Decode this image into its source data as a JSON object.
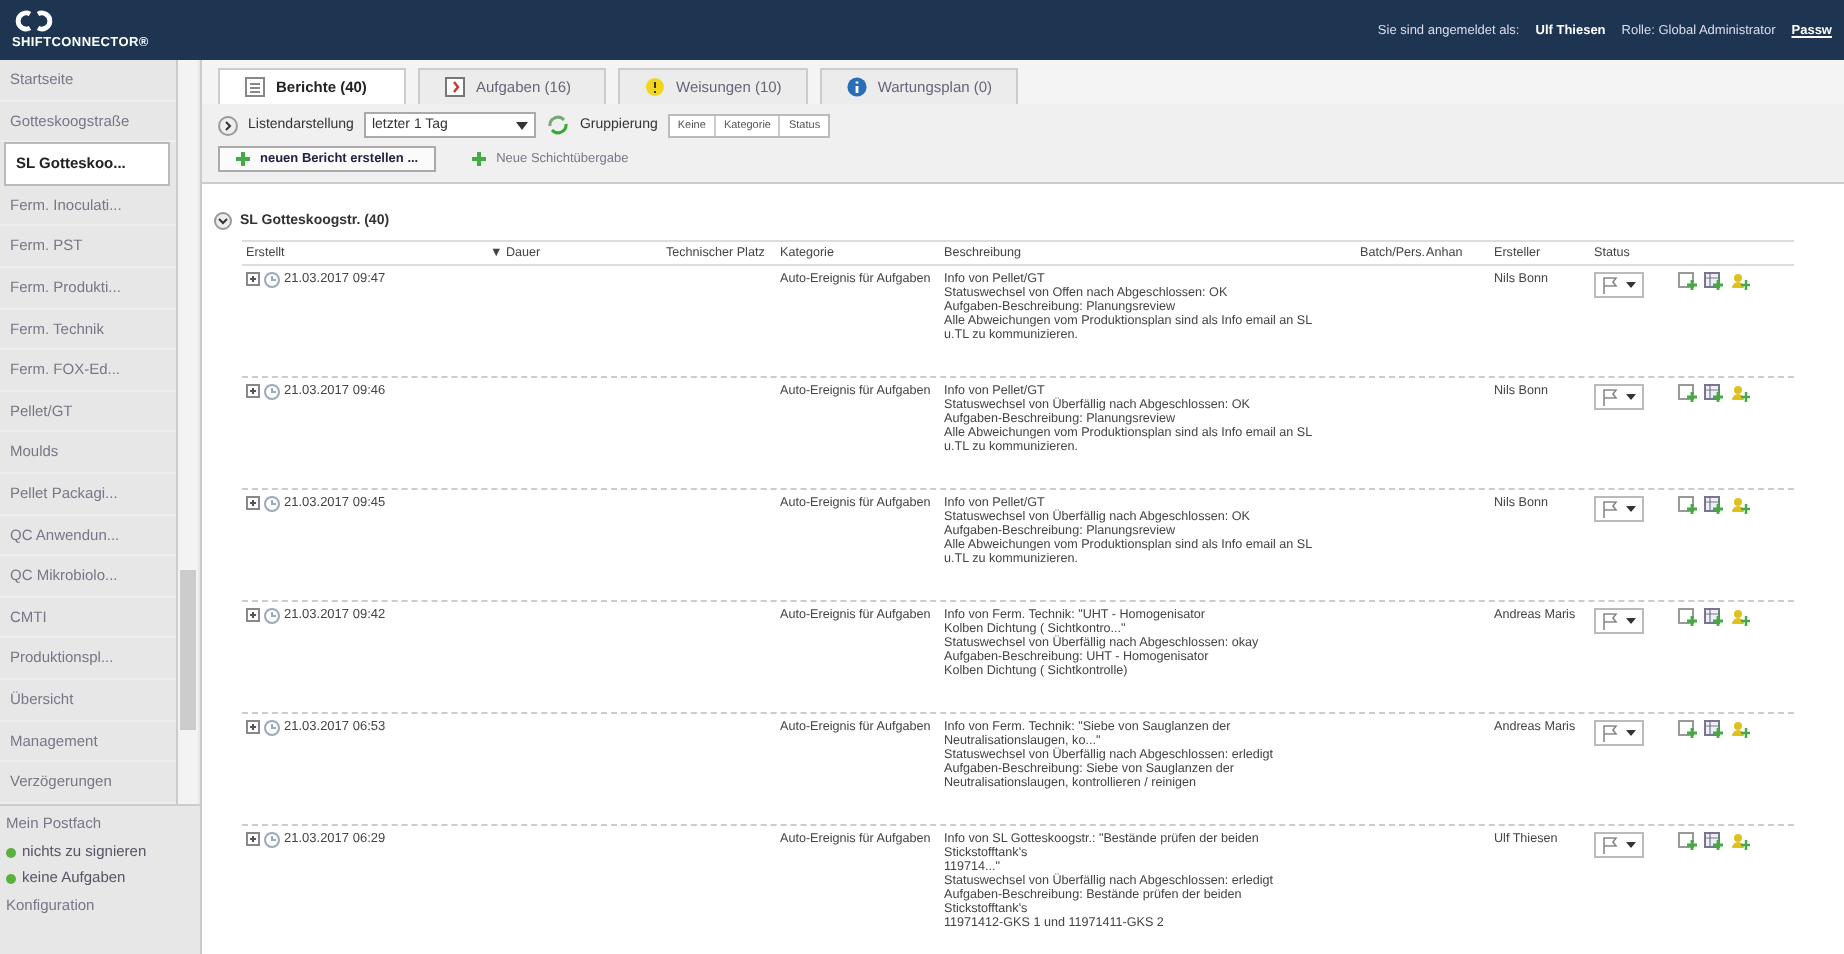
{
  "header": {
    "brand": "SHIFTCONNECTOR®",
    "login_label": "Sie sind angemeldet als:",
    "user": "Ulf Thiesen",
    "role": "Rolle: Global Administrator",
    "link": "Passw"
  },
  "sidebar": {
    "items": [
      {
        "label": "Startseite",
        "selected": false
      },
      {
        "label": "Gotteskoogstraße",
        "selected": false
      },
      {
        "label": "SL Gotteskoo...",
        "selected": true
      },
      {
        "label": "Ferm. Inoculati...",
        "selected": false
      },
      {
        "label": "Ferm. PST",
        "selected": false
      },
      {
        "label": "Ferm. Produkti...",
        "selected": false
      },
      {
        "label": "Ferm. Technik",
        "selected": false
      },
      {
        "label": "Ferm. FOX-Ed...",
        "selected": false
      },
      {
        "label": "Pellet/GT",
        "selected": false
      },
      {
        "label": "Moulds",
        "selected": false
      },
      {
        "label": "Pellet Packagi...",
        "selected": false
      },
      {
        "label": "QC Anwendun...",
        "selected": false
      },
      {
        "label": "QC Mikrobiolo...",
        "selected": false
      },
      {
        "label": "CMTI",
        "selected": false
      },
      {
        "label": "Produktionspl...",
        "selected": false
      },
      {
        "label": "Übersicht",
        "selected": false
      },
      {
        "label": "Management",
        "selected": false
      },
      {
        "label": "Verzögerungen",
        "selected": false
      }
    ],
    "mailbox": {
      "title": "Mein Postfach",
      "items": [
        {
          "label": "nichts zu signieren",
          "color": "#5cb040"
        },
        {
          "label": "keine Aufgaben",
          "color": "#5cb040"
        }
      ]
    },
    "config": "Konfiguration"
  },
  "tabs": [
    {
      "label": "Berichte (40)",
      "selected": true
    },
    {
      "label": "Aufgaben (16)",
      "selected": false
    },
    {
      "label": "Weisungen (10)",
      "selected": false
    },
    {
      "label": "Wartungsplan (0)",
      "selected": false
    }
  ],
  "toolbar": {
    "view_label": "Listendarstellung",
    "range": "letzter 1 Tag",
    "group_label": "Gruppierung",
    "grouping": [
      {
        "label": "Keine",
        "selected": false
      },
      {
        "label": "Kategorie",
        "selected": false
      },
      {
        "label": "Status",
        "selected": false
      }
    ],
    "buttons": [
      "neuen Bericht erstellen ...",
      "Neue Schichtübergabe"
    ]
  },
  "group": {
    "title": "SL Gotteskoogstr. (40)",
    "expanded": true
  },
  "table": {
    "columns": [
      "Erstellt",
      "▼ Dauer",
      "Technischer Platz",
      "Kategorie",
      "Beschreibung",
      "Batch/Pers.",
      "Anhan",
      "Ersteller",
      "Status"
    ],
    "rows": [
      {
        "created": "21.03.2017 09:47",
        "category": "Auto-Ereignis für Aufgaben",
        "description": [
          "Info von Pellet/GT",
          "Statuswechsel von Offen nach Abgeschlossen: OK",
          "Aufgaben-Beschreibung: Planungsreview",
          "Alle Abweichungen vom Produktionsplan sind als Info email an SL",
          "u.TL zu kommunizieren."
        ],
        "author": "Nils Bonn"
      },
      {
        "created": "21.03.2017 09:46",
        "category": "Auto-Ereignis für Aufgaben",
        "description": [
          "Info von Pellet/GT",
          "Statuswechsel von Überfällig nach Abgeschlossen: OK",
          "Aufgaben-Beschreibung: Planungsreview",
          "Alle Abweichungen vom Produktionsplan sind als Info email an SL",
          "u.TL zu kommunizieren."
        ],
        "author": "Nils Bonn"
      },
      {
        "created": "21.03.2017 09:45",
        "category": "Auto-Ereignis für Aufgaben",
        "description": [
          "Info von Pellet/GT",
          "Statuswechsel von Überfällig nach Abgeschlossen: OK",
          "Aufgaben-Beschreibung: Planungsreview",
          "Alle Abweichungen vom Produktionsplan sind als Info email an SL",
          "u.TL zu kommunizieren."
        ],
        "author": "Nils Bonn"
      },
      {
        "created": "21.03.2017 09:42",
        "category": "Auto-Ereignis für Aufgaben",
        "description": [
          "Info von Ferm. Technik: \"UHT - Homogenisator",
          "Kolben Dichtung ( Sichtkontro...\"",
          "Statuswechsel von Überfällig nach Abgeschlossen: okay",
          "Aufgaben-Beschreibung: UHT - Homogenisator",
          "Kolben Dichtung ( Sichtkontrolle)"
        ],
        "author": "Andreas Maris"
      },
      {
        "created": "21.03.2017 06:53",
        "category": "Auto-Ereignis für Aufgaben",
        "description": [
          "Info von Ferm. Technik: \"Siebe von Sauglanzen der",
          "Neutralisationslaugen, ko...\"",
          "Statuswechsel von Überfällig nach Abgeschlossen: erledigt",
          "Aufgaben-Beschreibung: Siebe von Sauglanzen der",
          "Neutralisationslaugen, kontrollieren / reinigen"
        ],
        "author": "Andreas Maris"
      },
      {
        "created": "21.03.2017 06:29",
        "category": "Auto-Ereignis für Aufgaben",
        "description": [
          "Info von SL Gotteskoogstr.: \"Bestände prüfen der beiden",
          "Stickstofftank's",
          "119714...\"",
          "Statuswechsel von Überfällig nach Abgeschlossen: erledigt",
          "Aufgaben-Beschreibung: Bestände prüfen der beiden",
          "Stickstofftank's",
          "11971412-GKS 1 und 11971411-GKS 2"
        ],
        "author": "Ulf Thiesen"
      }
    ]
  }
}
